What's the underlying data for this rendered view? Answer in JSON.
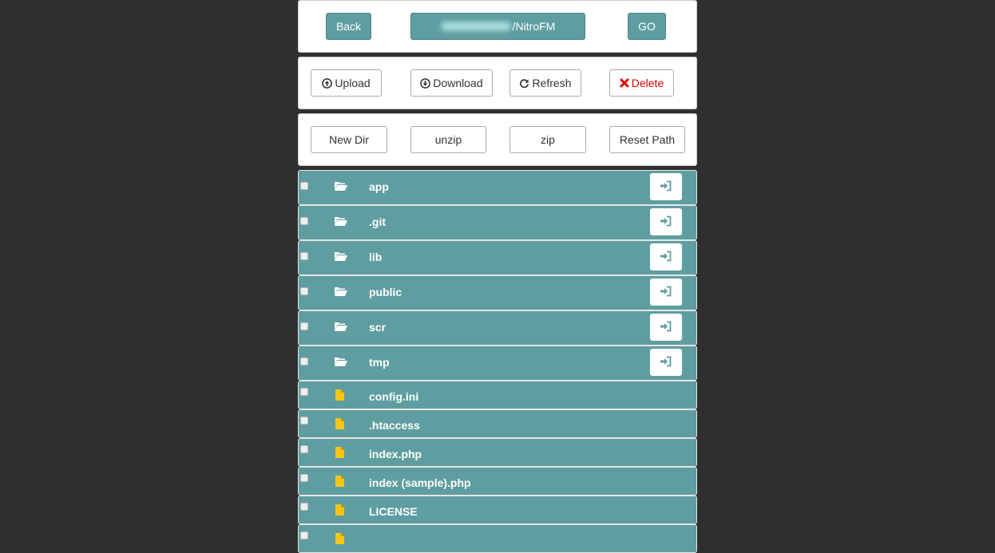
{
  "nav": {
    "back_label": "Back",
    "path_value": "/NitroFM",
    "go_label": "GO"
  },
  "toolbar": {
    "upload_label": "Upload",
    "download_label": "Download",
    "refresh_label": "Refresh",
    "delete_label": "Delete"
  },
  "actions": {
    "newdir_label": "New Dir",
    "unzip_label": "unzip",
    "zip_label": "zip",
    "resetpath_label": "Reset Path"
  },
  "folders": [
    {
      "name": "app",
      "icon": "folder-open-icon"
    },
    {
      "name": ".git",
      "icon": "folder-open-icon"
    },
    {
      "name": "lib",
      "icon": "folder-open-icon"
    },
    {
      "name": "public",
      "icon": "folder-open-icon"
    },
    {
      "name": "scr",
      "icon": "folder-open-icon"
    },
    {
      "name": "tmp",
      "icon": "folder-open-icon"
    }
  ],
  "files": [
    {
      "name": "config.ini",
      "icon": "file-icon"
    },
    {
      "name": ".htaccess",
      "icon": "file-icon"
    },
    {
      "name": "index.php",
      "icon": "file-icon"
    },
    {
      "name": "index (sample).php",
      "icon": "file-icon"
    },
    {
      "name": "LICENSE",
      "icon": "file-icon"
    },
    {
      "name": "",
      "icon": "file-icon"
    }
  ],
  "colors": {
    "background": "#2f2f2f",
    "accent": "#5f9ea0",
    "file_icon": "#f5c518",
    "delete": "#dd0000"
  }
}
